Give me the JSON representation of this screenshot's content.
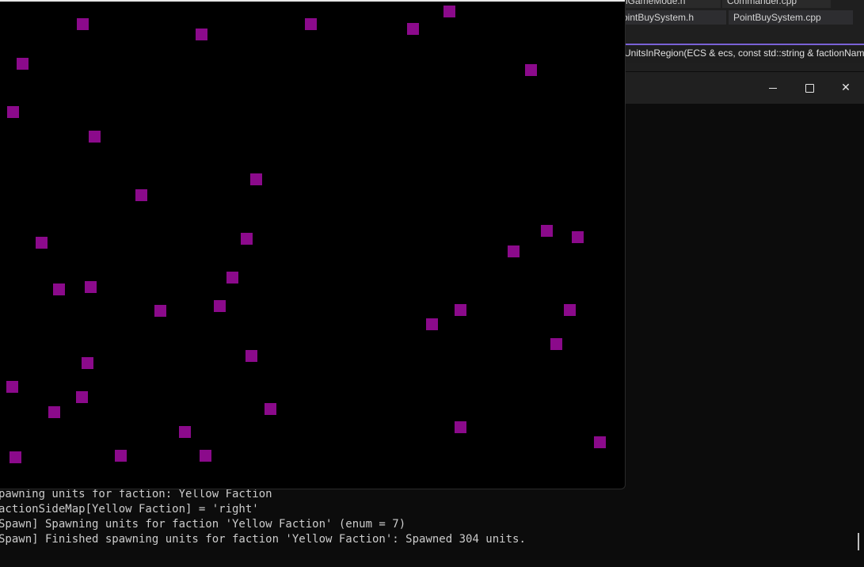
{
  "ide": {
    "tabs_row0": [
      "nGameMode.h",
      "Commander.cpp"
    ],
    "tabs_row1": [
      "ointBuySystem.h",
      "PointBuySystem.cpp"
    ],
    "signature": "UnitsInRegion(ECS & ecs, const std::string & factionName"
  },
  "terminal": {
    "lines": [
      "pawning units for faction: Yellow Faction",
      "actionSideMap[Yellow Faction] = 'right'",
      "Spawn] Spawning units for faction 'Yellow Faction' (enum = 7)",
      "Spawn] Finished spawning units for faction 'Yellow Faction': Spawned 304 units."
    ]
  },
  "game": {
    "unit_color": "#8b0a8b",
    "background": "#000000"
  },
  "window_controls": {
    "minimize_icon": "minimize-icon",
    "maximize_icon": "maximize-icon",
    "close_icon": "close-icon"
  }
}
